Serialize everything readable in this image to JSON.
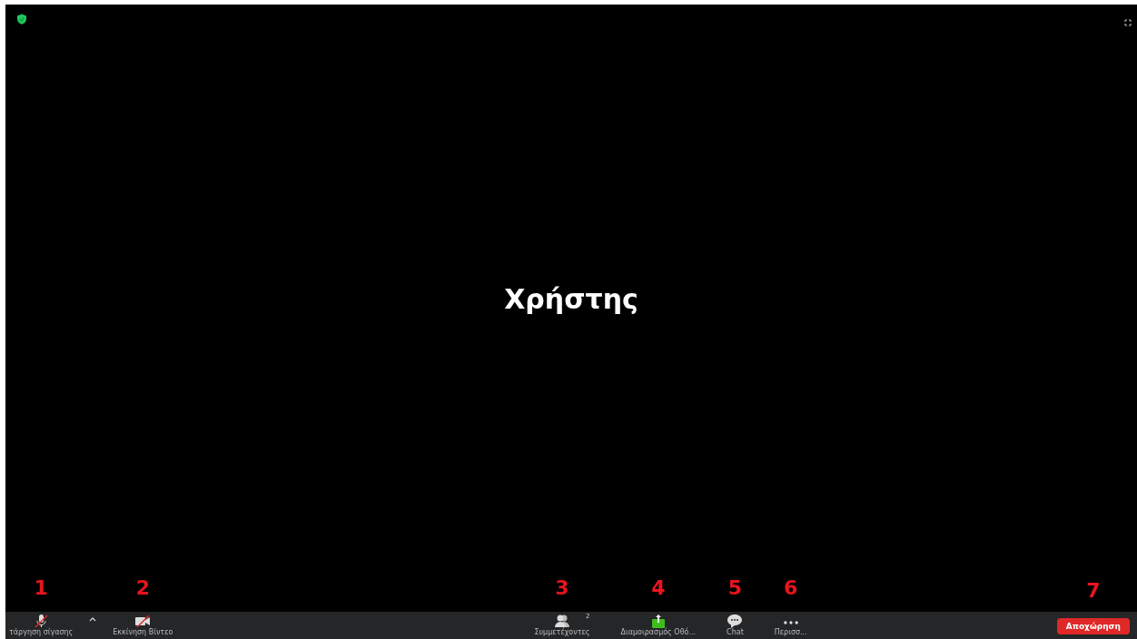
{
  "meeting": {
    "participant_name": "Χρήστης"
  },
  "toolbar": {
    "left": [
      {
        "kind": "mic",
        "label": "τάργηση σίγασης",
        "muted": true,
        "annotation": "1"
      },
      {
        "kind": "video",
        "label": "Εκκίνηση Βίντεο",
        "muted": true,
        "annotation": "2"
      }
    ],
    "center": [
      {
        "kind": "participants",
        "label": "Συμμετέχοντες",
        "count": "2",
        "annotation": "3"
      },
      {
        "kind": "share",
        "label": "Διαμοιρασμός Οθό...",
        "annotation": "4"
      },
      {
        "kind": "chat",
        "label": "Chat",
        "annotation": "5"
      },
      {
        "kind": "more",
        "label": "Περισσ...",
        "annotation": "6"
      }
    ],
    "leave": {
      "label": "Αποχώρηση",
      "annotation": "7"
    }
  }
}
